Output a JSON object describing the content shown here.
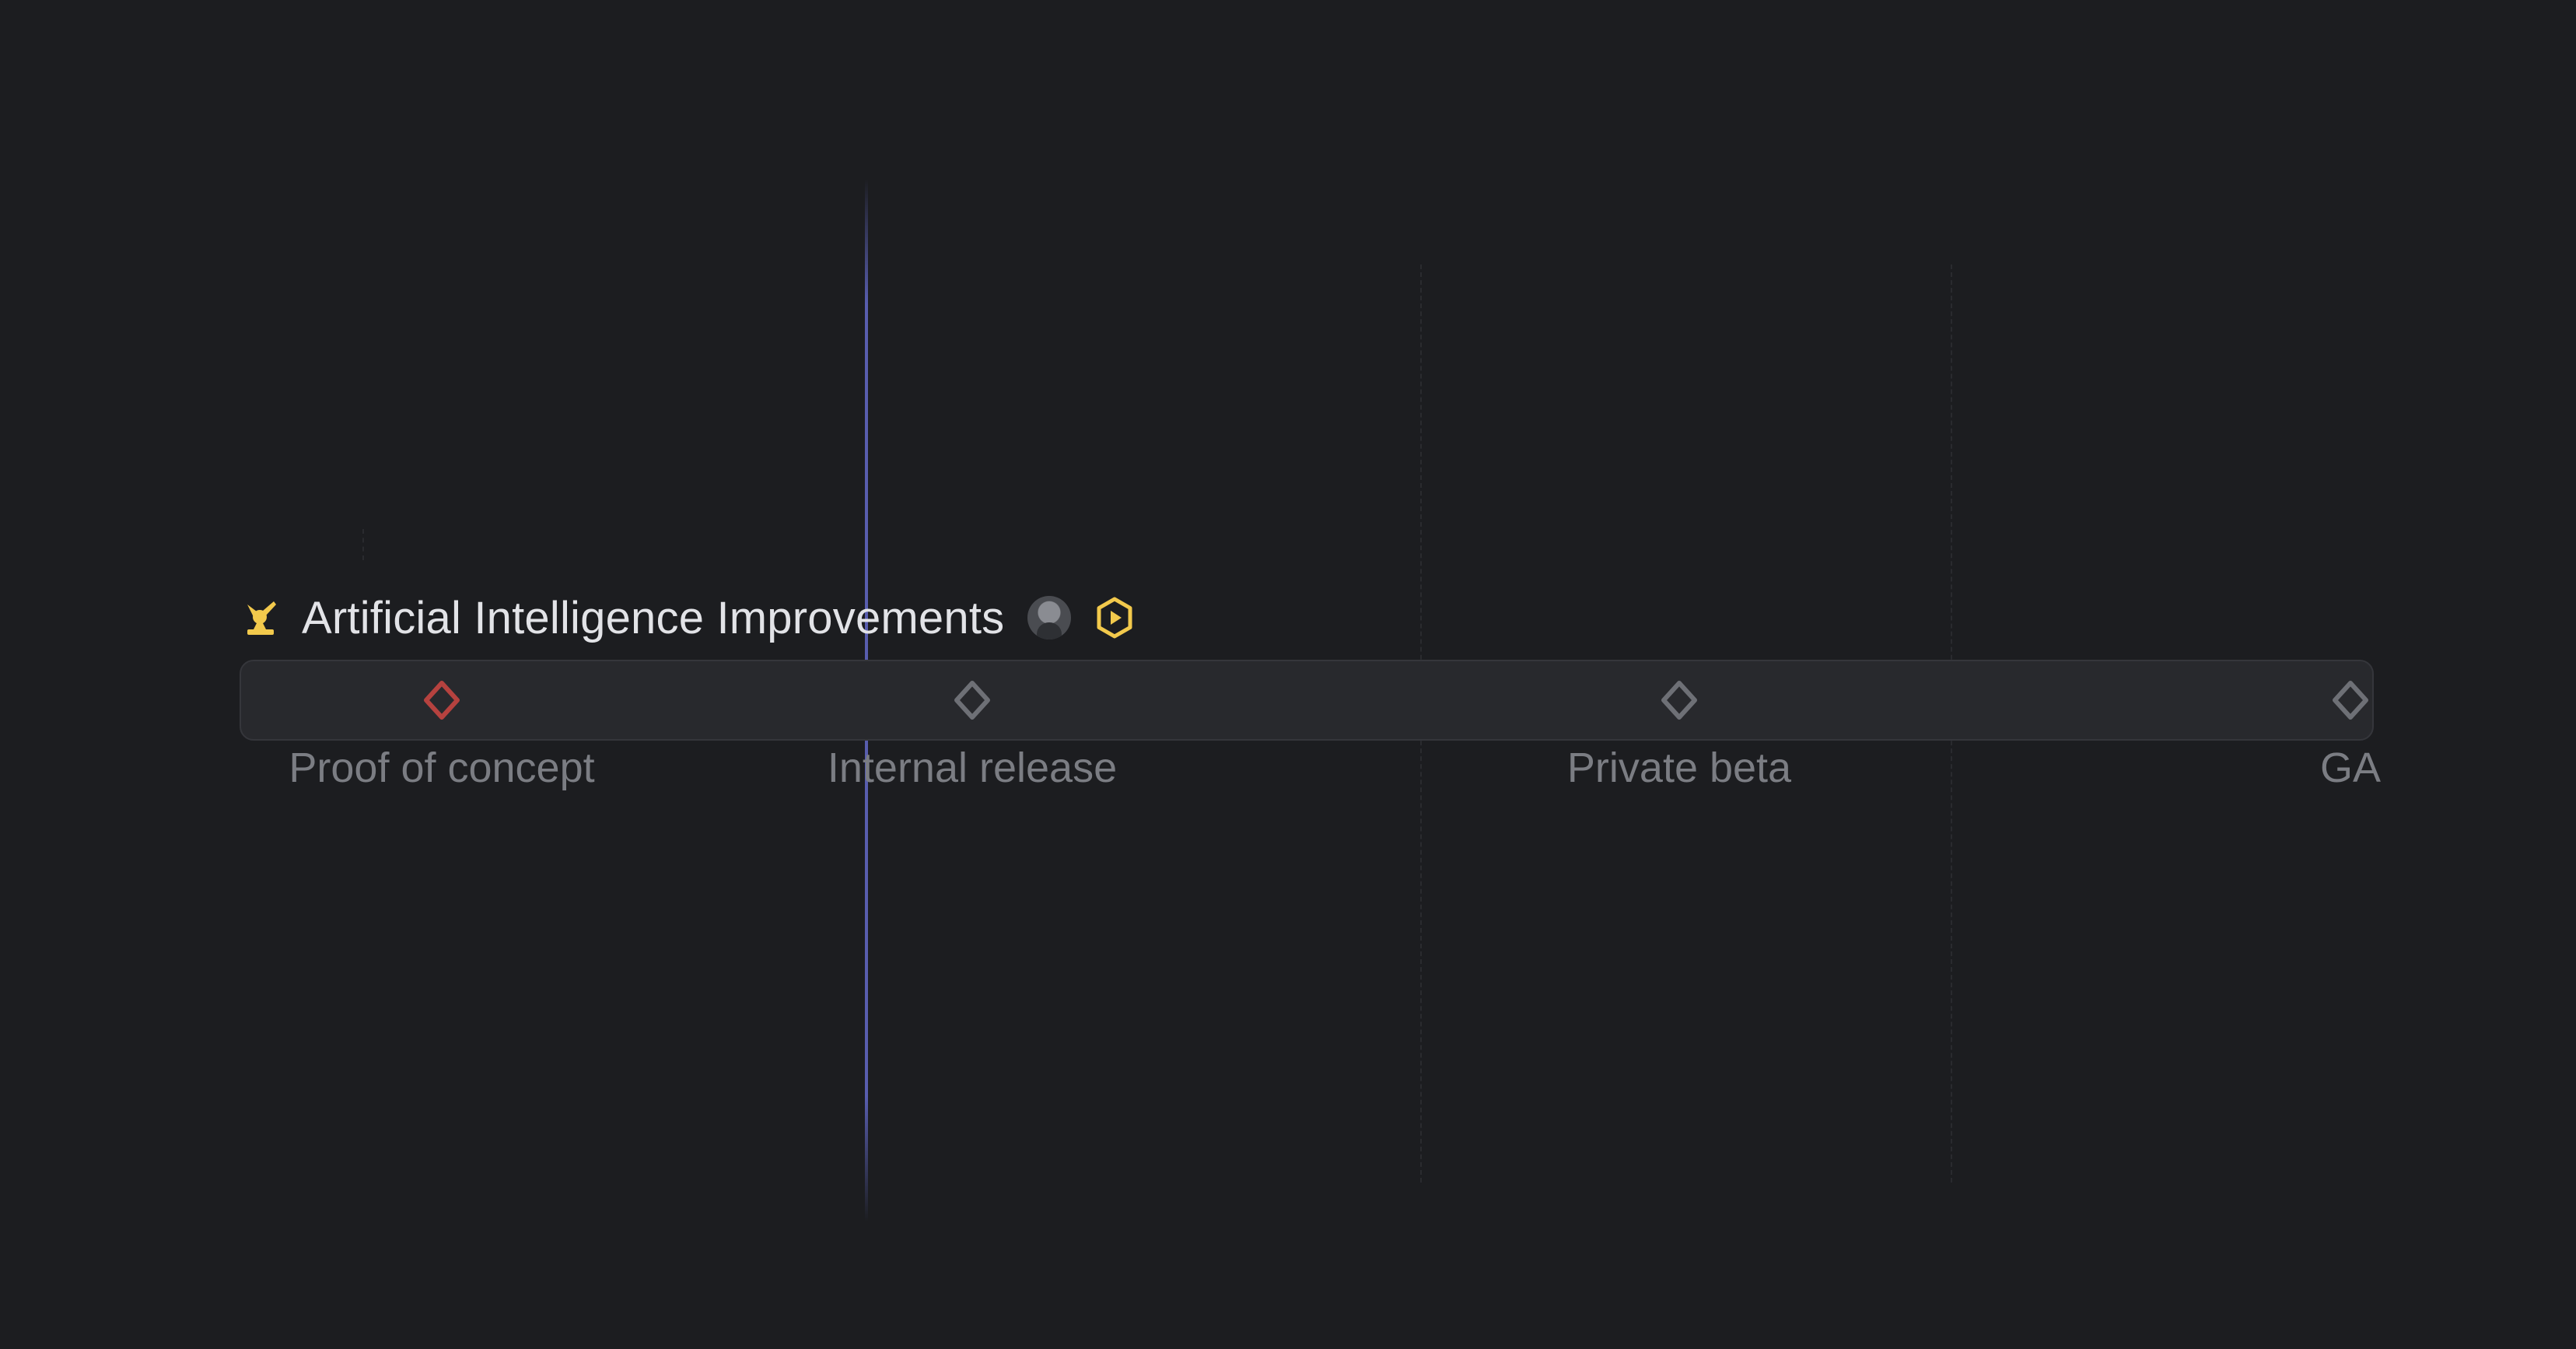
{
  "project": {
    "title": "Artificial Intelligence Improvements",
    "icon": "telescope-icon",
    "icon_color": "#f2c94c",
    "status_icon": "in-progress-hexagon-icon",
    "status_color": "#f2c94c",
    "lead_avatar": "avatar"
  },
  "milestones": [
    {
      "label": "Proof of concept",
      "icon": "diamond-icon",
      "color": "#b6423f",
      "state": "overdue"
    },
    {
      "label": "Internal release",
      "icon": "diamond-icon",
      "color": "#6e7076",
      "state": "upcoming"
    },
    {
      "label": "Private beta",
      "icon": "diamond-icon",
      "color": "#6e7076",
      "state": "upcoming"
    },
    {
      "label": "GA",
      "icon": "diamond-icon",
      "color": "#6e7076",
      "state": "upcoming"
    }
  ],
  "colors": {
    "background": "#1c1d20",
    "bar": "#28292d",
    "today_marker": "#5e64be",
    "label_text": "#7b7d83",
    "title_text": "#e2e3e7"
  }
}
